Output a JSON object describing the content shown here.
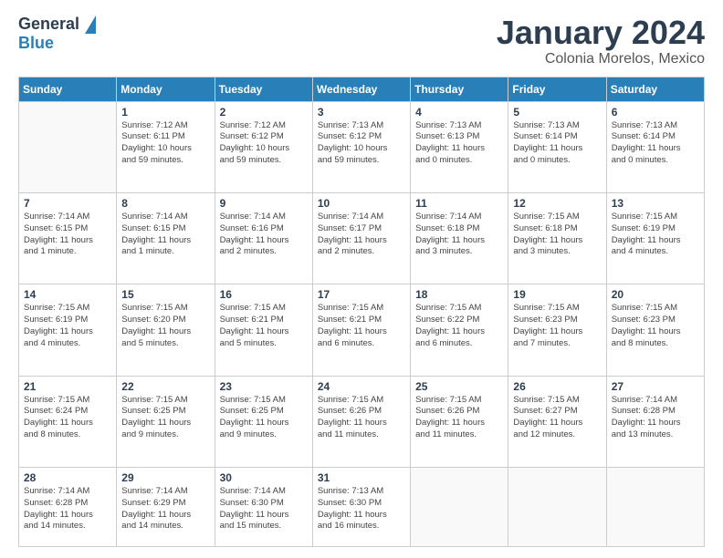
{
  "logo": {
    "general": "General",
    "blue": "Blue"
  },
  "header": {
    "month": "January 2024",
    "location": "Colonia Morelos, Mexico"
  },
  "weekdays": [
    "Sunday",
    "Monday",
    "Tuesday",
    "Wednesday",
    "Thursday",
    "Friday",
    "Saturday"
  ],
  "weeks": [
    [
      {
        "day": "",
        "info": ""
      },
      {
        "day": "1",
        "info": "Sunrise: 7:12 AM\nSunset: 6:11 PM\nDaylight: 10 hours\nand 59 minutes."
      },
      {
        "day": "2",
        "info": "Sunrise: 7:12 AM\nSunset: 6:12 PM\nDaylight: 10 hours\nand 59 minutes."
      },
      {
        "day": "3",
        "info": "Sunrise: 7:13 AM\nSunset: 6:12 PM\nDaylight: 10 hours\nand 59 minutes."
      },
      {
        "day": "4",
        "info": "Sunrise: 7:13 AM\nSunset: 6:13 PM\nDaylight: 11 hours\nand 0 minutes."
      },
      {
        "day": "5",
        "info": "Sunrise: 7:13 AM\nSunset: 6:14 PM\nDaylight: 11 hours\nand 0 minutes."
      },
      {
        "day": "6",
        "info": "Sunrise: 7:13 AM\nSunset: 6:14 PM\nDaylight: 11 hours\nand 0 minutes."
      }
    ],
    [
      {
        "day": "7",
        "info": "Sunrise: 7:14 AM\nSunset: 6:15 PM\nDaylight: 11 hours\nand 1 minute."
      },
      {
        "day": "8",
        "info": "Sunrise: 7:14 AM\nSunset: 6:15 PM\nDaylight: 11 hours\nand 1 minute."
      },
      {
        "day": "9",
        "info": "Sunrise: 7:14 AM\nSunset: 6:16 PM\nDaylight: 11 hours\nand 2 minutes."
      },
      {
        "day": "10",
        "info": "Sunrise: 7:14 AM\nSunset: 6:17 PM\nDaylight: 11 hours\nand 2 minutes."
      },
      {
        "day": "11",
        "info": "Sunrise: 7:14 AM\nSunset: 6:18 PM\nDaylight: 11 hours\nand 3 minutes."
      },
      {
        "day": "12",
        "info": "Sunrise: 7:15 AM\nSunset: 6:18 PM\nDaylight: 11 hours\nand 3 minutes."
      },
      {
        "day": "13",
        "info": "Sunrise: 7:15 AM\nSunset: 6:19 PM\nDaylight: 11 hours\nand 4 minutes."
      }
    ],
    [
      {
        "day": "14",
        "info": "Sunrise: 7:15 AM\nSunset: 6:19 PM\nDaylight: 11 hours\nand 4 minutes."
      },
      {
        "day": "15",
        "info": "Sunrise: 7:15 AM\nSunset: 6:20 PM\nDaylight: 11 hours\nand 5 minutes."
      },
      {
        "day": "16",
        "info": "Sunrise: 7:15 AM\nSunset: 6:21 PM\nDaylight: 11 hours\nand 5 minutes."
      },
      {
        "day": "17",
        "info": "Sunrise: 7:15 AM\nSunset: 6:21 PM\nDaylight: 11 hours\nand 6 minutes."
      },
      {
        "day": "18",
        "info": "Sunrise: 7:15 AM\nSunset: 6:22 PM\nDaylight: 11 hours\nand 6 minutes."
      },
      {
        "day": "19",
        "info": "Sunrise: 7:15 AM\nSunset: 6:23 PM\nDaylight: 11 hours\nand 7 minutes."
      },
      {
        "day": "20",
        "info": "Sunrise: 7:15 AM\nSunset: 6:23 PM\nDaylight: 11 hours\nand 8 minutes."
      }
    ],
    [
      {
        "day": "21",
        "info": "Sunrise: 7:15 AM\nSunset: 6:24 PM\nDaylight: 11 hours\nand 8 minutes."
      },
      {
        "day": "22",
        "info": "Sunrise: 7:15 AM\nSunset: 6:25 PM\nDaylight: 11 hours\nand 9 minutes."
      },
      {
        "day": "23",
        "info": "Sunrise: 7:15 AM\nSunset: 6:25 PM\nDaylight: 11 hours\nand 9 minutes."
      },
      {
        "day": "24",
        "info": "Sunrise: 7:15 AM\nSunset: 6:26 PM\nDaylight: 11 hours\nand 11 minutes."
      },
      {
        "day": "25",
        "info": "Sunrise: 7:15 AM\nSunset: 6:26 PM\nDaylight: 11 hours\nand 11 minutes."
      },
      {
        "day": "26",
        "info": "Sunrise: 7:15 AM\nSunset: 6:27 PM\nDaylight: 11 hours\nand 12 minutes."
      },
      {
        "day": "27",
        "info": "Sunrise: 7:14 AM\nSunset: 6:28 PM\nDaylight: 11 hours\nand 13 minutes."
      }
    ],
    [
      {
        "day": "28",
        "info": "Sunrise: 7:14 AM\nSunset: 6:28 PM\nDaylight: 11 hours\nand 14 minutes."
      },
      {
        "day": "29",
        "info": "Sunrise: 7:14 AM\nSunset: 6:29 PM\nDaylight: 11 hours\nand 14 minutes."
      },
      {
        "day": "30",
        "info": "Sunrise: 7:14 AM\nSunset: 6:30 PM\nDaylight: 11 hours\nand 15 minutes."
      },
      {
        "day": "31",
        "info": "Sunrise: 7:13 AM\nSunset: 6:30 PM\nDaylight: 11 hours\nand 16 minutes."
      },
      {
        "day": "",
        "info": ""
      },
      {
        "day": "",
        "info": ""
      },
      {
        "day": "",
        "info": ""
      }
    ]
  ]
}
